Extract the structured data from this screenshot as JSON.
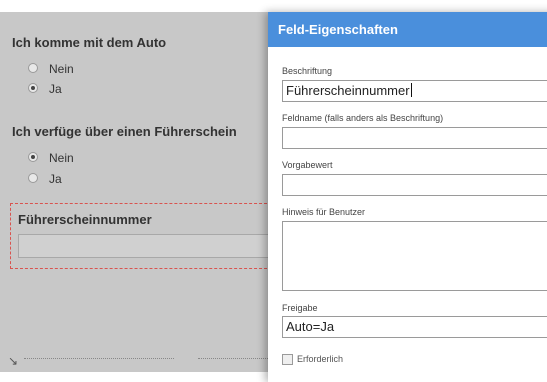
{
  "form": {
    "question1": {
      "title": "Ich komme mit dem Auto",
      "options": [
        {
          "label": "Nein",
          "checked": false
        },
        {
          "label": "Ja",
          "checked": true
        }
      ]
    },
    "question2": {
      "title": "Ich verfüge über einen Führerschein",
      "options": [
        {
          "label": "Nein",
          "checked": true
        },
        {
          "label": "Ja",
          "checked": false
        }
      ]
    },
    "selected_field": {
      "title": "Führerscheinnummer"
    }
  },
  "panel": {
    "title": "Feld-Eigenschaften",
    "caption_label": "Beschriftung",
    "caption_value": "Führerscheinnummer",
    "fieldname_label": "Feldname (falls anders als Beschriftung)",
    "fieldname_value": "",
    "default_label": "Vorgabewert",
    "default_value": "",
    "hint_label": "Hinweis für Benutzer",
    "hint_value": "",
    "release_label": "Freigabe",
    "release_value": "Auto=Ja",
    "required_label": "Erforderlich",
    "required_checked": false
  },
  "colors": {
    "panel_header": "#4a8fdc",
    "selection_border": "#d9534f"
  }
}
